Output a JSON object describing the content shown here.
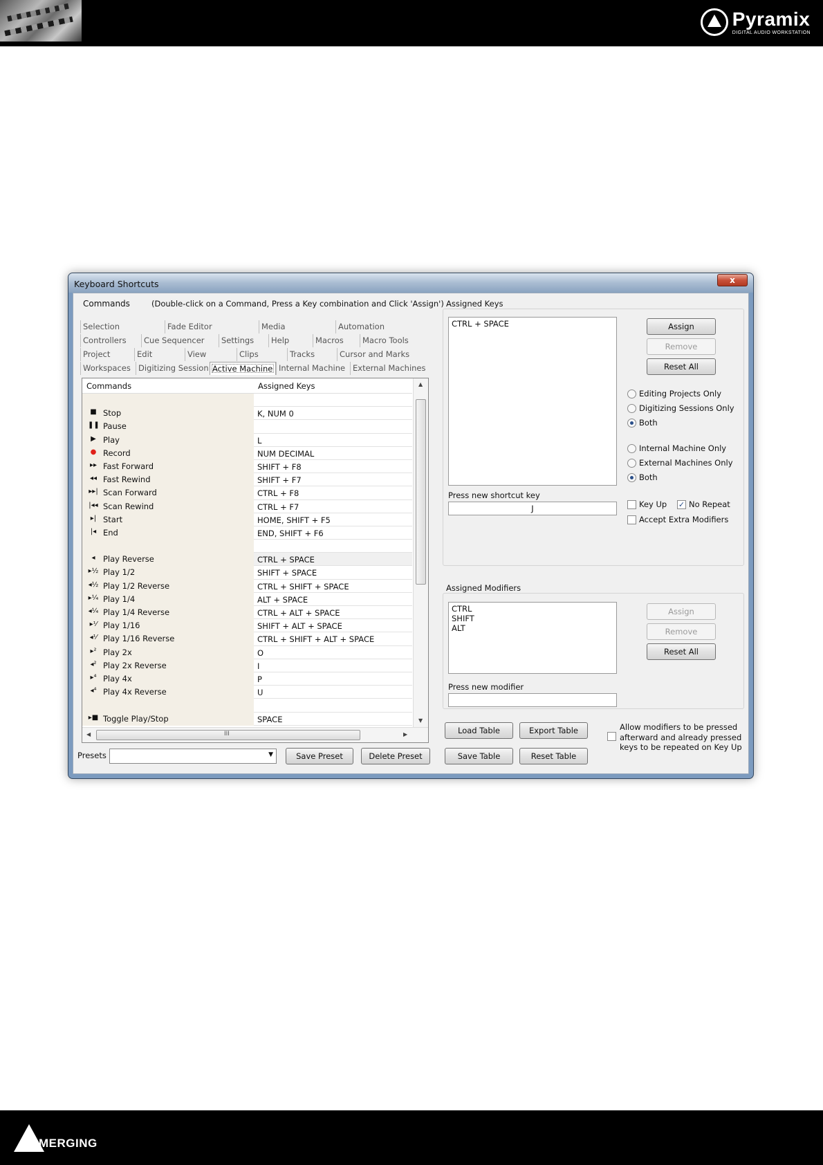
{
  "header": {
    "brand_name": "Pyramix",
    "brand_subtitle": "DIGITAL AUDIO WORKSTATION"
  },
  "footer": {
    "company": "MERGING"
  },
  "window": {
    "title": "Keyboard Shortcuts",
    "close_label": "x"
  },
  "commands_panel": {
    "label": "Commands",
    "hint": "(Double-click on a Command, Press a Key combination and Click 'Assign')",
    "tabs": [
      [
        "Selection",
        "Fade Editor",
        "Media",
        "Automation"
      ],
      [
        "Controllers",
        "Cue Sequencer",
        "Settings",
        "Help",
        "Macros",
        "Macro Tools"
      ],
      [
        "Project",
        "Edit",
        "View",
        "Clips",
        "Tracks",
        "Cursor and Marks"
      ],
      [
        "Workspaces",
        "Digitizing Session",
        "Active Machine",
        "Internal Machine",
        "External Machines"
      ]
    ],
    "active_tab": "Active Machine",
    "columns": [
      "Commands",
      "Assigned Keys"
    ],
    "rows": [
      {
        "icon": "",
        "name": "",
        "keys": ""
      },
      {
        "icon": "■",
        "name": "Stop",
        "keys": "K, NUM 0"
      },
      {
        "icon": "❚❚",
        "name": "Pause",
        "keys": ""
      },
      {
        "icon": "▶",
        "name": "Play",
        "keys": "L"
      },
      {
        "icon": "●",
        "name": "Record",
        "keys": "NUM DECIMAL",
        "icon_color": "#e0211a"
      },
      {
        "icon": "▸▸",
        "name": "Fast Forward",
        "keys": "SHIFT + F8"
      },
      {
        "icon": "◂◂",
        "name": "Fast Rewind",
        "keys": "SHIFT + F7"
      },
      {
        "icon": "▸▸|",
        "name": "Scan Forward",
        "keys": "CTRL + F8"
      },
      {
        "icon": "|◂◂",
        "name": "Scan Rewind",
        "keys": "CTRL + F7"
      },
      {
        "icon": "▸|",
        "name": "Start",
        "keys": "HOME, SHIFT + F5"
      },
      {
        "icon": "|◂",
        "name": "End",
        "keys": "END, SHIFT + F6"
      },
      {
        "icon": "",
        "name": "",
        "keys": ""
      },
      {
        "icon": "◂",
        "name": "Play Reverse",
        "keys": "CTRL + SPACE",
        "selected": true
      },
      {
        "icon": "▸½",
        "name": "Play 1/2",
        "keys": "SHIFT + SPACE"
      },
      {
        "icon": "◂½",
        "name": "Play 1/2 Reverse",
        "keys": "CTRL + SHIFT + SPACE"
      },
      {
        "icon": "▸¼",
        "name": "Play 1/4",
        "keys": "ALT + SPACE"
      },
      {
        "icon": "◂¼",
        "name": "Play 1/4 Reverse",
        "keys": "CTRL + ALT + SPACE"
      },
      {
        "icon": "▸⅟",
        "name": "Play 1/16",
        "keys": "SHIFT + ALT + SPACE"
      },
      {
        "icon": "◂⅟",
        "name": "Play 1/16 Reverse",
        "keys": "CTRL + SHIFT + ALT + SPACE"
      },
      {
        "icon": "▸²",
        "name": "Play 2x",
        "keys": "O"
      },
      {
        "icon": "◂²",
        "name": "Play 2x Reverse",
        "keys": "I"
      },
      {
        "icon": "▸⁴",
        "name": "Play 4x",
        "keys": "P"
      },
      {
        "icon": "◂⁴",
        "name": "Play 4x Reverse",
        "keys": "U"
      },
      {
        "icon": "",
        "name": "",
        "keys": ""
      },
      {
        "icon": "▸■",
        "name": "Toggle Play/Stop",
        "keys": "SPACE"
      }
    ],
    "scroll_grip": "III"
  },
  "presets": {
    "label": "Presets",
    "selected_value": "",
    "save_label": "Save Preset",
    "delete_label": "Delete Preset"
  },
  "assigned_keys": {
    "group_label": "Assigned Keys",
    "items": [
      "CTRL + SPACE"
    ],
    "assign_label": "Assign",
    "remove_label": "Remove",
    "reset_label": "Reset All",
    "scope_options": [
      "Editing Projects Only",
      "Digitizing Sessions Only",
      "Both"
    ],
    "scope_selected": "Both",
    "machine_options": [
      "Internal Machine Only",
      "External Machines Only",
      "Both"
    ],
    "machine_selected": "Both",
    "shortcut_label": "Press new shortcut key",
    "shortcut_value": "J",
    "key_up_label": "Key Up",
    "key_up_checked": false,
    "no_repeat_label": "No Repeat",
    "no_repeat_checked": true,
    "accept_extra_label": "Accept Extra Modifiers",
    "accept_extra_checked": false
  },
  "assigned_modifiers": {
    "group_label": "Assigned Modifiers",
    "items": [
      "CTRL",
      "SHIFT",
      "ALT"
    ],
    "assign_label": "Assign",
    "remove_label": "Remove",
    "reset_label": "Reset All",
    "modifier_label": "Press new modifier",
    "modifier_value": ""
  },
  "table_actions": {
    "load_label": "Load Table",
    "export_label": "Export Table",
    "save_label": "Save Table",
    "reset_label": "Reset Table",
    "allow_modifiers_text": "Allow modifiers to be pressed afterward and already pressed keys to be repeated on Key Up",
    "allow_modifiers_checked": false
  }
}
